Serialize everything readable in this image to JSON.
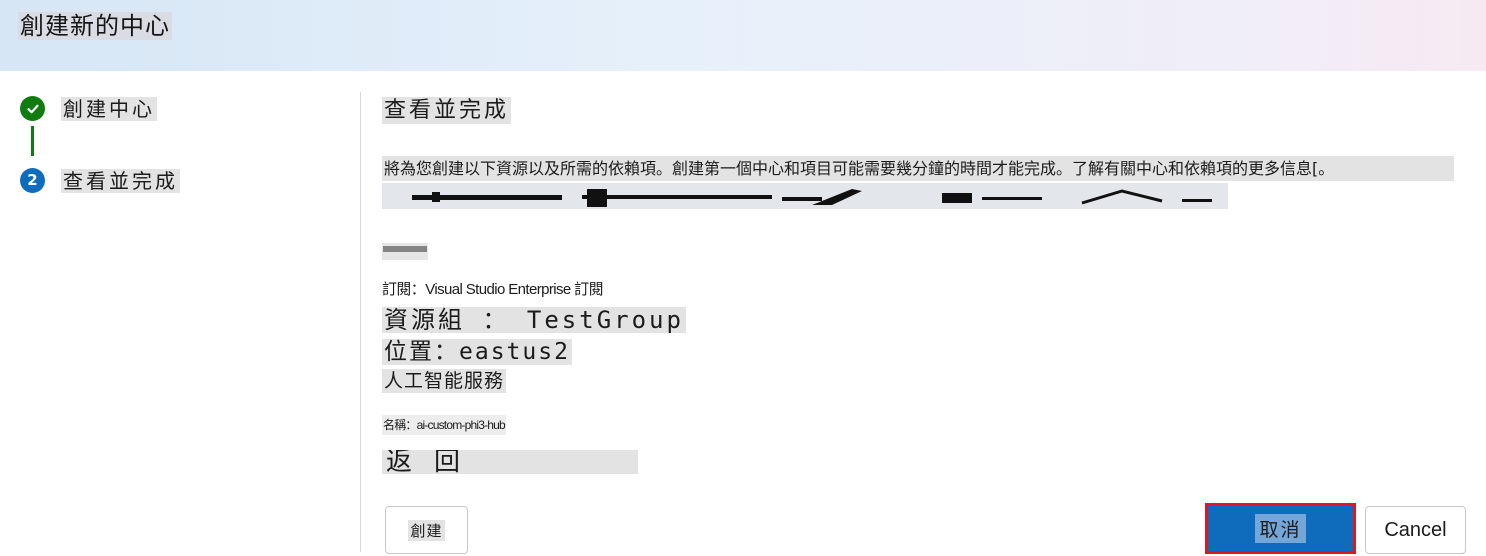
{
  "header": {
    "title": "創建新的中心"
  },
  "steps": [
    {
      "label": "創建中心",
      "status": "completed",
      "icon": "checkmark-icon"
    },
    {
      "label": "查看並完成",
      "status": "current",
      "number": "2"
    }
  ],
  "main": {
    "section_title": "查看並完成",
    "description": "將為您創建以下資源以及所需的依賴項。創建第一個中心和項目可能需要幾分鐘的時間才能完成。了解有關中心和依賴項的更多信息[。",
    "subscription": "訂閱：Visual Studio Enterprise 訂閱",
    "resource_group": "資源組 ： TestGroup",
    "location": "位置：eastus2",
    "ai_services_heading": "人工智能服務",
    "name": "名稱：ai-custom-phi3-hub",
    "back_link": "返回"
  },
  "buttons": {
    "create": "創建",
    "cancel_primary": "取消",
    "cancel": "Cancel"
  },
  "colors": {
    "success": "#107c10",
    "primary": "#0f6cbd",
    "highlight_border": "#e0171e"
  }
}
